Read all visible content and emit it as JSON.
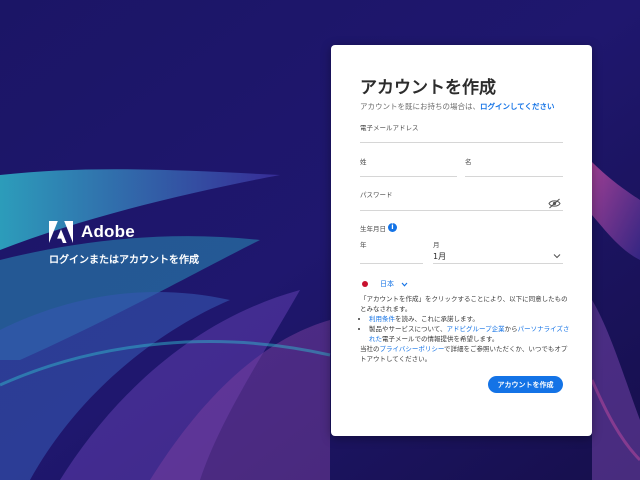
{
  "brand": {
    "name": "Adobe",
    "tagline": "ログインまたはアカウントを作成"
  },
  "form": {
    "title": "アカウントを作成",
    "signin_prompt": "アカウントを既にお持ちの場合は、",
    "signin_link": "ログインしてください",
    "email_label": "電子メールアドレス",
    "last_name_label": "姓",
    "first_name_label": "名",
    "password_label": "パスワード",
    "birthdate_label": "生年月日",
    "year_label": "年",
    "month_label": "月",
    "month_value": "1月",
    "country": "日本",
    "terms": {
      "intro": "「アカウントを作成」をクリックすることにより、以下に同意したものとみなされます。",
      "bullet1_link": "利用条件",
      "bullet1_text": "を読み、これに承諾します。",
      "bullet2_pre": "製品やサービスについて、",
      "bullet2_link1": "アドビグループ企業",
      "bullet2_mid": "から",
      "bullet2_link2": "パーソナライズされた",
      "bullet2_post": "電子メールでの情報提供を希望します。",
      "privacy_pre": "当社の",
      "privacy_link": "プライバシーポリシー",
      "privacy_post": "で詳細をご参照いただくか、いつでもオプトアウトしてください。"
    },
    "submit_label": "アカウントを作成"
  },
  "colors": {
    "accent": "#1473e6",
    "background": "#1b1260",
    "card": "#ffffff"
  },
  "icons": [
    "adobe-logo",
    "eye-off-icon",
    "info-icon",
    "chevron-down-icon",
    "japan-flag-icon"
  ]
}
